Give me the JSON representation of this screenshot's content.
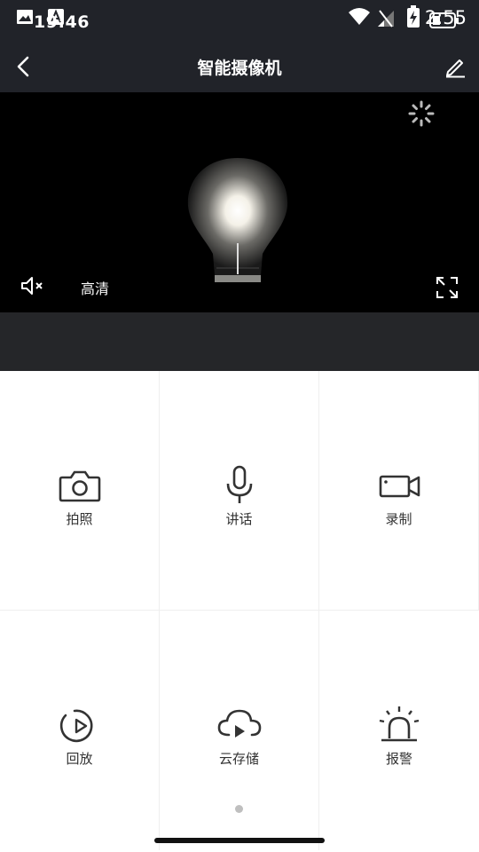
{
  "status_bar": {
    "time_left": "19:46",
    "time_right": "2:55"
  },
  "header": {
    "title": "智能摄像机"
  },
  "video": {
    "quality_label": "高清"
  },
  "actions": [
    {
      "label": "拍照",
      "icon": "camera-icon"
    },
    {
      "label": "讲话",
      "icon": "microphone-icon"
    },
    {
      "label": "录制",
      "icon": "video-camera-icon"
    },
    {
      "label": "回放",
      "icon": "playback-icon"
    },
    {
      "label": "云存储",
      "icon": "cloud-play-icon"
    },
    {
      "label": "报警",
      "icon": "alarm-icon"
    }
  ],
  "colors": {
    "header_bg": "#212329",
    "video_bg": "#000000",
    "controls_bg": "#252629"
  }
}
